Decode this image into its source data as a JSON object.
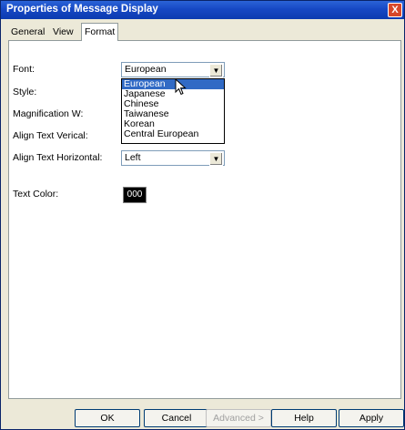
{
  "window": {
    "title": "Properties of Message Display",
    "close_glyph": "X"
  },
  "tabs": [
    {
      "label": "General"
    },
    {
      "label": "View"
    },
    {
      "label": "Format",
      "active": true
    }
  ],
  "form": {
    "font_label": "Font:",
    "font_value": "European",
    "style_label": "Style:",
    "magnification_label": "Magnification W:",
    "align_vertical_label": "Align Text Verical:",
    "align_horizontal_label": "Align Text Horizontal:",
    "align_horizontal_value": "Left",
    "text_color_label": "Text Color:",
    "text_color_value": "000"
  },
  "font_options": [
    "European",
    "Japanese",
    "Chinese",
    "Taiwanese",
    "Korean",
    "Central European"
  ],
  "buttons": {
    "ok": "OK",
    "cancel": "Cancel",
    "advanced": "Advanced >",
    "help": "Help",
    "apply": "Apply"
  },
  "colors": {
    "accent": "#316ac5",
    "title_bar": "#1648c4",
    "text_color_swatch": "#000000"
  }
}
